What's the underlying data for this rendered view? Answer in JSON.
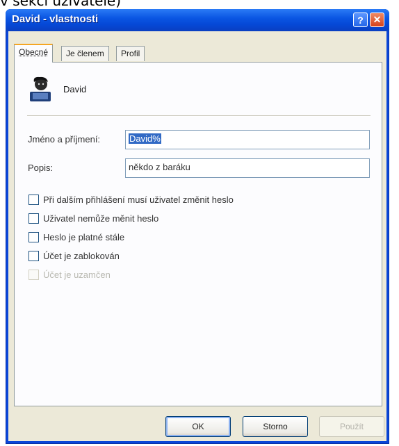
{
  "caption": "v sekci uživatelé)",
  "window": {
    "title": "David - vlastnosti",
    "help_button": "?",
    "close_button": "✕"
  },
  "tabs": [
    {
      "label": "Obecné",
      "active": true
    },
    {
      "label": "Je členem",
      "active": false
    },
    {
      "label": "Profil",
      "active": false
    }
  ],
  "user": {
    "name": "David",
    "icon": "user-icon"
  },
  "fields": {
    "full_name": {
      "label": "Jméno a příjmení:",
      "value": "David%"
    },
    "description": {
      "label": "Popis:",
      "value": "někdo z baráku"
    }
  },
  "checkboxes": [
    {
      "label": "Při dalším přihlášení musí uživatel změnit heslo",
      "checked": false,
      "enabled": true
    },
    {
      "label": "Uživatel nemůže měnit heslo",
      "checked": false,
      "enabled": true
    },
    {
      "label": "Heslo je platné stále",
      "checked": false,
      "enabled": true
    },
    {
      "label": "Účet je zablokován",
      "checked": false,
      "enabled": true
    },
    {
      "label": "Účet je uzamčen",
      "checked": false,
      "enabled": false
    }
  ],
  "buttons": {
    "ok": "OK",
    "cancel": "Storno",
    "apply": "Použít"
  },
  "colors": {
    "titlebar": "#0b56e3",
    "dialog_bg": "#ece9d8",
    "selection": "#316ac5",
    "tab_accent": "#f5a623"
  }
}
